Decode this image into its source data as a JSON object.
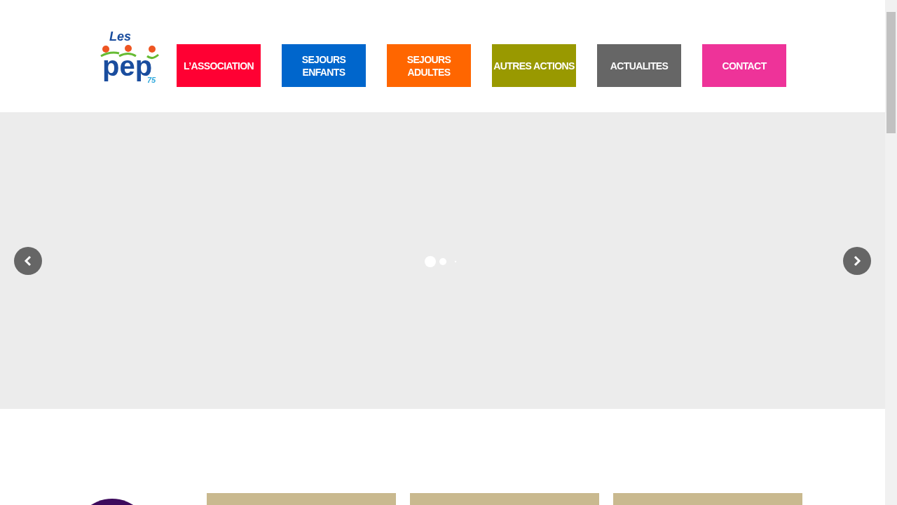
{
  "logo": {
    "top": "Les",
    "main": "pep",
    "number": "75"
  },
  "menu": [
    {
      "label": "L’ASSOCIATION",
      "color": "#ff0033"
    },
    {
      "label": "SEJOURS ENFANTS",
      "color": "#0066cc"
    },
    {
      "label": "SEJOURS ADULTES",
      "color": "#ff6600"
    },
    {
      "label": "AUTRES ACTIONS",
      "color": "#999900"
    },
    {
      "label": "ACTUALITES",
      "color": "#666666"
    },
    {
      "label": "CONTACT",
      "color": "#ee3399"
    }
  ],
  "tiles": [
    {
      "kind": "circle"
    },
    {
      "kind": "photo"
    },
    {
      "kind": "photo"
    },
    {
      "kind": "photo"
    }
  ]
}
